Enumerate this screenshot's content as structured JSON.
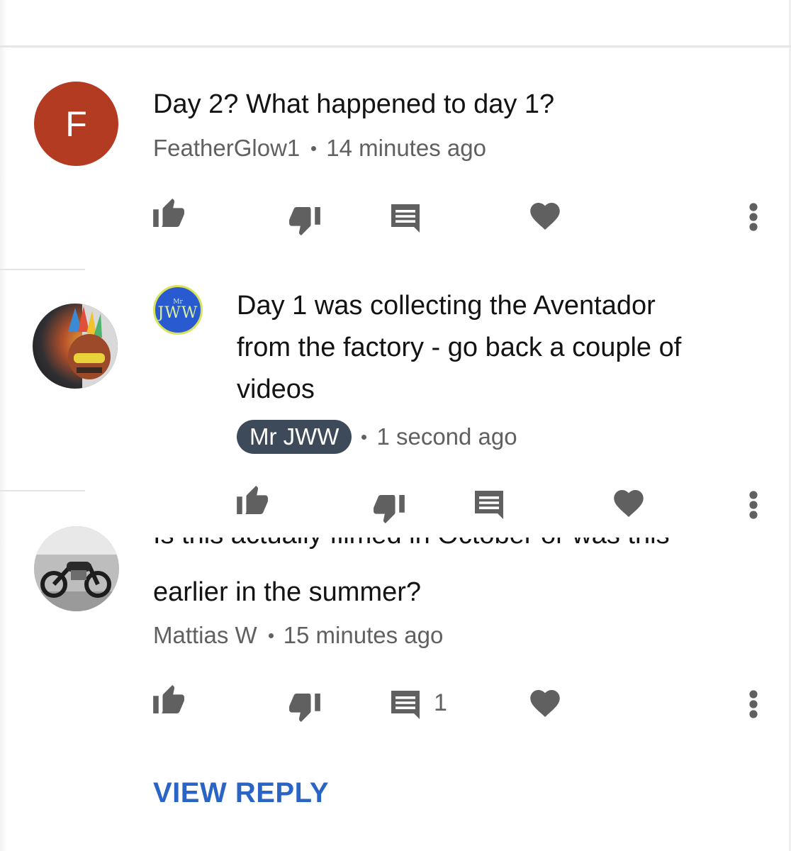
{
  "comments": [
    {
      "avatar_letter": "F",
      "text": "Day 2? What happened to day 1?",
      "author": "FeatherGlow1",
      "time": "14 minutes ago"
    },
    {
      "avatar_logo_small": "Mr",
      "avatar_logo": "JWW",
      "text_lines": [
        "Day 1 was collecting the Aventador",
        "from the factory - go back a couple of",
        "videos"
      ],
      "author": "Mr JWW",
      "time": "1 second ago"
    },
    {
      "text_cut": "Is this actually filmed in October or was this",
      "text": "earlier in the summer?",
      "author": "Mattias W",
      "time": "15 minutes ago",
      "reply_count": "1"
    }
  ],
  "view_reply_label": "VIEW REPLY",
  "colors": {
    "avatar_f": "#b33b22",
    "owner_badge": "#3d4a5a",
    "link_blue": "#2a64c5",
    "icon_gray": "#606060"
  },
  "icons": [
    "thumb-up-icon",
    "thumb-down-icon",
    "reply-icon",
    "heart-icon",
    "more-vert-icon"
  ]
}
